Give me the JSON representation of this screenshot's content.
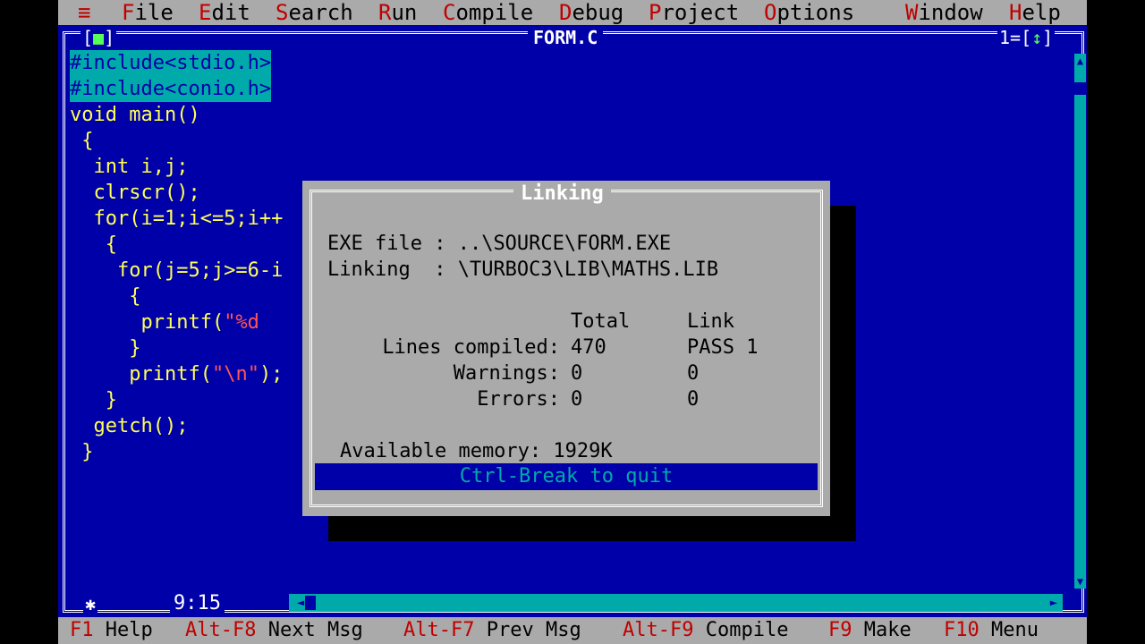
{
  "menubar": {
    "system": "≡",
    "items": [
      {
        "hot": "F",
        "rest": "ile"
      },
      {
        "hot": "E",
        "rest": "dit"
      },
      {
        "hot": "S",
        "rest": "earch"
      },
      {
        "hot": "R",
        "rest": "un"
      },
      {
        "hot": "C",
        "rest": "ompile"
      },
      {
        "hot": "D",
        "rest": "ebug"
      },
      {
        "hot": "P",
        "rest": "roject"
      },
      {
        "hot": "O",
        "rest": "ptions"
      },
      {
        "hot": "W",
        "rest": "indow"
      },
      {
        "hot": "H",
        "rest": "elp"
      }
    ]
  },
  "editor": {
    "close_box_open": "[",
    "close_box_mark": "■",
    "close_box_close": "]",
    "title": "FORM.C",
    "window_number": "1=[",
    "window_zoom": "↕",
    "window_close": "]",
    "cursor_position": "9:15",
    "modified_marker": "✱",
    "code": [
      {
        "text": "#include<stdio.h>",
        "selected": true
      },
      {
        "text": "#include<conio.h>",
        "selected": true
      },
      {
        "text": "void main()"
      },
      {
        "text": " {"
      },
      {
        "text": "  int i,j;"
      },
      {
        "text": "  clrscr();"
      },
      {
        "text": "  for(i=1;i<=5;i++"
      },
      {
        "text": "   {"
      },
      {
        "text": "    for(j=5;j>=6-i"
      },
      {
        "text": "     {"
      },
      {
        "pre": "      printf(",
        "str": "\"%d"
      },
      {
        "text": "     }"
      },
      {
        "pre": "     printf(",
        "str": "\"\\n\"",
        "post": ");"
      },
      {
        "text": "   }"
      },
      {
        "text": "  getch();"
      },
      {
        "text": " }"
      }
    ]
  },
  "dialog": {
    "title": "Linking",
    "exe_label": "EXE file : ",
    "exe_value": "..\\SOURCE\\FORM.EXE",
    "linking_label": "Linking  : ",
    "linking_value": "\\TURBOC3\\LIB\\MATHS.LIB",
    "col_total": "Total",
    "col_link": "Link",
    "lines_label": "Lines compiled:",
    "lines_total": "470",
    "lines_link": "PASS 1",
    "warnings_label": "Warnings:",
    "warnings_total": "0",
    "warnings_link": "0",
    "errors_label": "Errors:",
    "errors_total": "0",
    "errors_link": "0",
    "memory_label": "Available memory:",
    "memory_value": "1929K",
    "quit": "Ctrl-Break to quit"
  },
  "statusbar": {
    "keys": [
      {
        "key": "F1",
        "label": "Help"
      },
      {
        "key": "Alt-F8",
        "label": "Next Msg"
      },
      {
        "key": "Alt-F7",
        "label": "Prev Msg"
      },
      {
        "key": "Alt-F9",
        "label": "Compile"
      },
      {
        "key": "F9",
        "label": "Make"
      },
      {
        "key": "F10",
        "label": "Menu"
      }
    ]
  },
  "colors": {
    "background": "#0000A8",
    "menu_bg": "#AAAAAA",
    "hotkey": "#C00000",
    "code": "#FFFF55",
    "selection": "#00AAAA",
    "string": "#FF5555"
  }
}
